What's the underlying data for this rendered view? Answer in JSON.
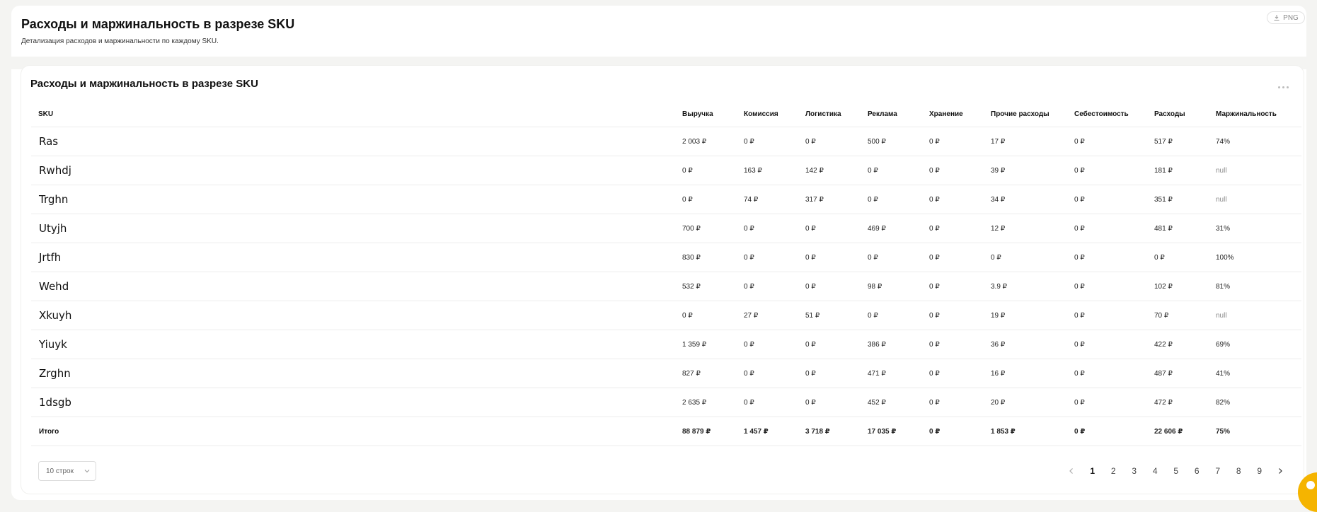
{
  "header": {
    "title": "Расходы и маржинальность в разрезе SKU",
    "subtitle": "Детализация расходов и маржинальности по каждому SKU.",
    "export_label": "PNG"
  },
  "card": {
    "title": "Расходы и маржинальность в разрезе SKU"
  },
  "table": {
    "columns": [
      "SKU",
      "Выручка",
      "Комиссия",
      "Логистика",
      "Реклама",
      "Хранение",
      "Прочие расходы",
      "Себестоимость",
      "Расходы",
      "Маржинальность"
    ],
    "rows": [
      [
        "Ras",
        "2 003 ₽",
        "0 ₽",
        "0 ₽",
        "500 ₽",
        "0 ₽",
        "17 ₽",
        "0 ₽",
        "517 ₽",
        "74%"
      ],
      [
        "Rwhdj",
        "0 ₽",
        "163 ₽",
        "142 ₽",
        "0 ₽",
        "0 ₽",
        "39 ₽",
        "0 ₽",
        "181 ₽",
        "null"
      ],
      [
        "Trghn",
        "0 ₽",
        "74 ₽",
        "317 ₽",
        "0 ₽",
        "0 ₽",
        "34 ₽",
        "0 ₽",
        "351 ₽",
        "null"
      ],
      [
        "Utyjh",
        "700 ₽",
        "0 ₽",
        "0 ₽",
        "469 ₽",
        "0 ₽",
        "12 ₽",
        "0 ₽",
        "481 ₽",
        "31%"
      ],
      [
        "Jrtfh",
        "830 ₽",
        "0 ₽",
        "0 ₽",
        "0 ₽",
        "0 ₽",
        "0 ₽",
        "0 ₽",
        "0 ₽",
        "100%"
      ],
      [
        "Wehd",
        "532 ₽",
        "0 ₽",
        "0 ₽",
        "98 ₽",
        "0 ₽",
        "3.9 ₽",
        "0 ₽",
        "102 ₽",
        "81%"
      ],
      [
        "Xkuyh",
        "0 ₽",
        "27 ₽",
        "51 ₽",
        "0 ₽",
        "0 ₽",
        "19 ₽",
        "0 ₽",
        "70 ₽",
        "null"
      ],
      [
        "Yiuyk",
        "1 359 ₽",
        "0 ₽",
        "0 ₽",
        "386 ₽",
        "0 ₽",
        "36 ₽",
        "0 ₽",
        "422 ₽",
        "69%"
      ],
      [
        "Zrghn",
        "827 ₽",
        "0 ₽",
        "0 ₽",
        "471 ₽",
        "0 ₽",
        "16 ₽",
        "0 ₽",
        "487 ₽",
        "41%"
      ],
      [
        "1dsgb",
        "2 635 ₽",
        "0 ₽",
        "0 ₽",
        "452 ₽",
        "0 ₽",
        "20 ₽",
        "0 ₽",
        "472 ₽",
        "82%"
      ]
    ],
    "total": [
      "Итого",
      "88 879 ₽",
      "1 457 ₽",
      "3 718 ₽",
      "17 035 ₽",
      "0 ₽",
      "1 853 ₽",
      "0 ₽",
      "22 606 ₽",
      "75%"
    ]
  },
  "pagination": {
    "rows_per_page": "10 строк",
    "pages": [
      "1",
      "2",
      "3",
      "4",
      "5",
      "6",
      "7",
      "8",
      "9"
    ],
    "current_page": "1"
  },
  "colors": {
    "accent": "#f5b400",
    "muted": "#888888"
  },
  "icons": [
    "download-icon",
    "more-dots-icon",
    "chevron-down-icon",
    "chevron-left-icon",
    "chevron-right-icon"
  ]
}
